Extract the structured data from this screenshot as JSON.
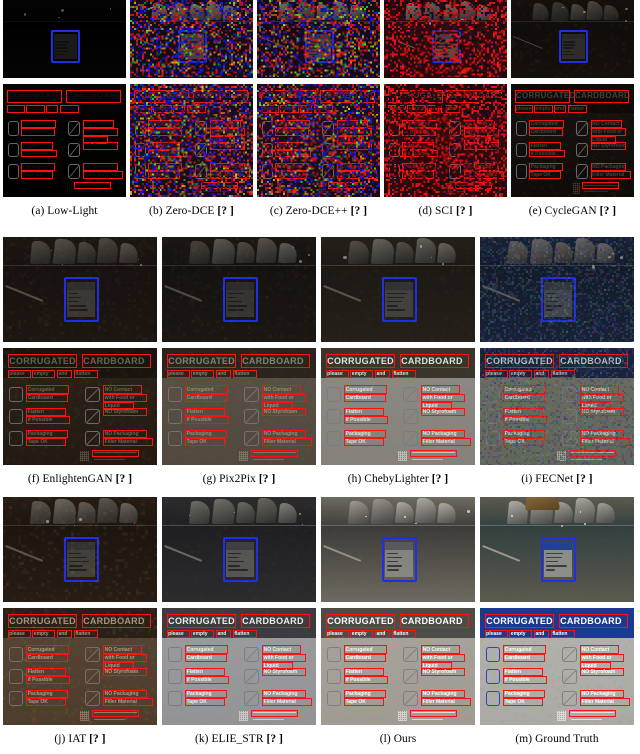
{
  "figure": {
    "type": "qualitative-comparison-grid",
    "total_panels": 13,
    "rows_per_panel": 2,
    "row_description": [
      "full-scene low-light image with blue ROI box",
      "zoomed ROI crop with red text-detection boxes"
    ]
  },
  "groups": [
    {
      "id": "group-1",
      "columns": 5,
      "panels": [
        {
          "key": "a",
          "label": "(a) Low-Light",
          "metric": "",
          "style": "black"
        },
        {
          "key": "b",
          "label": "(b) Zero-DCE",
          "metric": "[? ]",
          "style": "noise-rgb"
        },
        {
          "key": "c",
          "label": "(c) Zero-DCE++",
          "metric": "[? ]",
          "style": "noise-rgb"
        },
        {
          "key": "d",
          "label": "(d) SCI",
          "metric": "[? ]",
          "style": "noise-red"
        },
        {
          "key": "e",
          "label": "(e) CycleGAN",
          "metric": "[? ]",
          "style": "very-dark"
        }
      ]
    },
    {
      "id": "group-2",
      "columns": 4,
      "panels": [
        {
          "key": "f",
          "label": "(f) EnlightenGAN",
          "metric": "[? ]",
          "style": "dark-brown"
        },
        {
          "key": "g",
          "label": "(g) Pix2Pix",
          "metric": "[? ]",
          "style": "dark-gray"
        },
        {
          "key": "h",
          "label": "(h) ChebyLighter",
          "metric": "[? ]",
          "style": "mid-gray"
        },
        {
          "key": "i",
          "label": "(i) FECNet",
          "metric": "[? ]",
          "style": "blue-green-noise"
        }
      ]
    },
    {
      "id": "group-3",
      "columns": 4,
      "panels": [
        {
          "key": "j",
          "label": "(j) IAT",
          "metric": "[? ]",
          "style": "brown"
        },
        {
          "key": "k",
          "label": "(k) ELIE_STR",
          "metric": "[? ]",
          "style": "gray-bright"
        },
        {
          "key": "l",
          "label": "(l) Ours",
          "metric": "",
          "style": "natural"
        },
        {
          "key": "m",
          "label": "(m) Ground Truth",
          "metric": "",
          "style": "natural-blue-sign"
        }
      ]
    }
  ],
  "sign_text": {
    "headline_1": "CORRUGATED",
    "headline_2": "CARDBOARD",
    "subline": [
      "please",
      "empty",
      "and",
      "flatten"
    ],
    "left_items": [
      [
        "Corrugated",
        "Cardboard"
      ],
      [
        "Flatten",
        "if Possible"
      ],
      [
        "Packaging",
        "Tape OK"
      ]
    ],
    "right_items": [
      [
        "NO Contact",
        "with Food or",
        "Liquid"
      ],
      [
        "NO Styrofoam"
      ],
      [
        "NO Packaging",
        "Filler Material"
      ]
    ],
    "footer": "recycle"
  },
  "colors": {
    "roi_box": "#1f2fe8",
    "detection_box": "#ff1111",
    "sign_blue": "#1b3a8f",
    "page_background": "#ffffff",
    "caption_text": "#000000"
  }
}
